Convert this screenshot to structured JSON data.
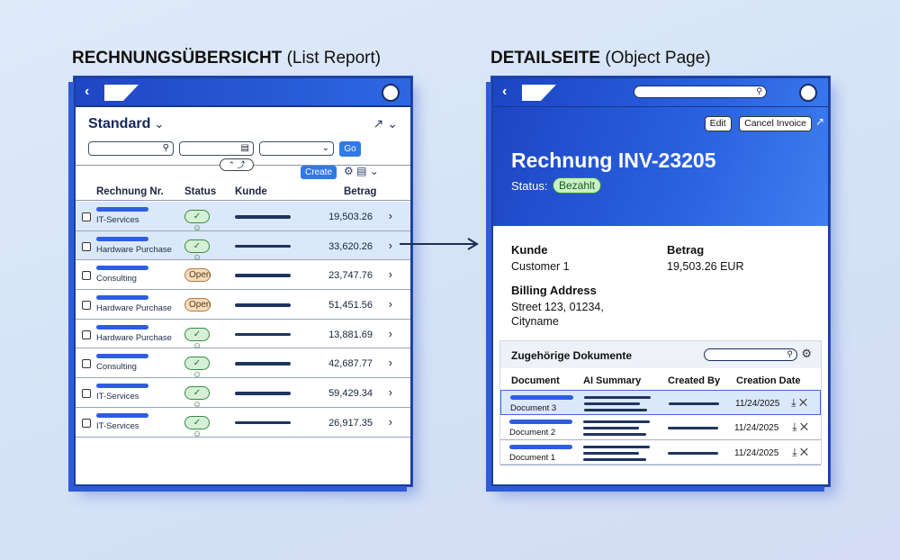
{
  "captions": {
    "left_bold": "RECHNUNGSÜBERSICHT",
    "left_rest": "(List Report)",
    "right_bold": "DETAILSEITE",
    "right_rest": "(Object Page)"
  },
  "list_report": {
    "variant": "Standard",
    "go_label": "Go",
    "create_label": "Create",
    "columns": [
      "Rechnung Nr.",
      "Status",
      "Kunde",
      "Betrag"
    ],
    "rows": [
      {
        "category": "IT-Services",
        "status": "ok",
        "amount": "19,503.26",
        "selected": true
      },
      {
        "category": "Hardware Purchase",
        "status": "ok",
        "amount": "33,620.26",
        "selected": true
      },
      {
        "category": "Consulting",
        "status": "open",
        "status_label": "Open",
        "amount": "23,747.76",
        "selected": false
      },
      {
        "category": "Hardware Purchase",
        "status": "open",
        "status_label": "Open",
        "amount": "51,451.56",
        "selected": false
      },
      {
        "category": "Hardware Purchase",
        "status": "ok",
        "amount": "13,881.69",
        "selected": false
      },
      {
        "category": "Consulting",
        "status": "ok",
        "amount": "42,687.77",
        "selected": false
      },
      {
        "category": "IT-Services",
        "status": "ok",
        "amount": "59,429.34",
        "selected": false
      },
      {
        "category": "IT-Services",
        "status": "ok",
        "amount": "26,917.35",
        "selected": false
      }
    ]
  },
  "object_page": {
    "edit_label": "Edit",
    "cancel_label": "Cancel Invoice",
    "title": "Rechnung INV-23205",
    "status_label": "Status:",
    "status_value": "Bezahlt",
    "kunde_label": "Kunde",
    "kunde_value": "Customer 1",
    "betrag_label": "Betrag",
    "betrag_value": "19,503.26 EUR",
    "billing_label": "Billing Address",
    "billing_line1": "Street 123, 01234,",
    "billing_line2": "Cityname",
    "docs_title": "Zugehörige Dokumente",
    "docs_columns": [
      "Document",
      "AI Summary",
      "Created By",
      "Creation Date"
    ],
    "docs": [
      {
        "name": "Document 3",
        "date": "11/24/2025",
        "selected": true
      },
      {
        "name": "Document 2",
        "date": "11/24/2025",
        "selected": false
      },
      {
        "name": "Document 1",
        "date": "11/24/2025",
        "selected": false
      }
    ]
  },
  "colors": {
    "brand_blue": "#2d67e2",
    "success_green": "#3a8a40",
    "open_orange": "#b07a40"
  }
}
